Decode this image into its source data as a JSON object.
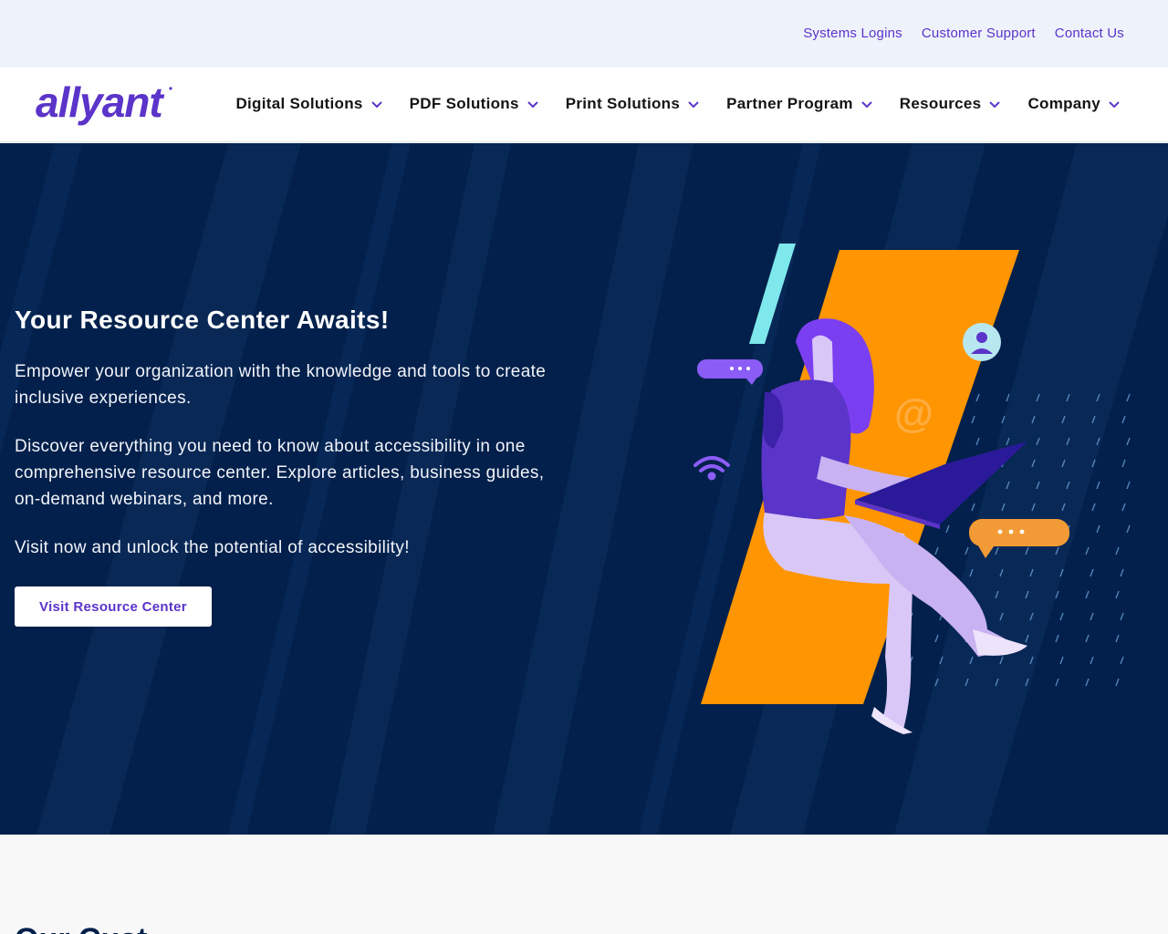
{
  "utility_nav": {
    "links": [
      "Systems Logins",
      "Customer Support",
      "Contact Us"
    ]
  },
  "brand": {
    "logo_text": "allyant",
    "color": "#5b34c9"
  },
  "main_nav": {
    "items": [
      "Digital Solutions",
      "PDF Solutions",
      "Print Solutions",
      "Partner Program",
      "Resources",
      "Company"
    ]
  },
  "hero": {
    "title": "Your Resource Center Awaits!",
    "paragraphs": [
      "Empower your organization with the knowledge and tools to create inclusive experiences.",
      "Discover everything you need to know about accessibility in one comprehensive resource center. Explore articles, business guides, on-demand webinars, and more.",
      "Visit now and unlock the potential of accessibility!"
    ],
    "cta_label": "Visit Resource Center",
    "background_color": "#02204b",
    "accent_orange": "#ff9500",
    "accent_cyan": "#7ee8ec"
  },
  "next_section": {
    "title_partial": "Our Cust"
  }
}
